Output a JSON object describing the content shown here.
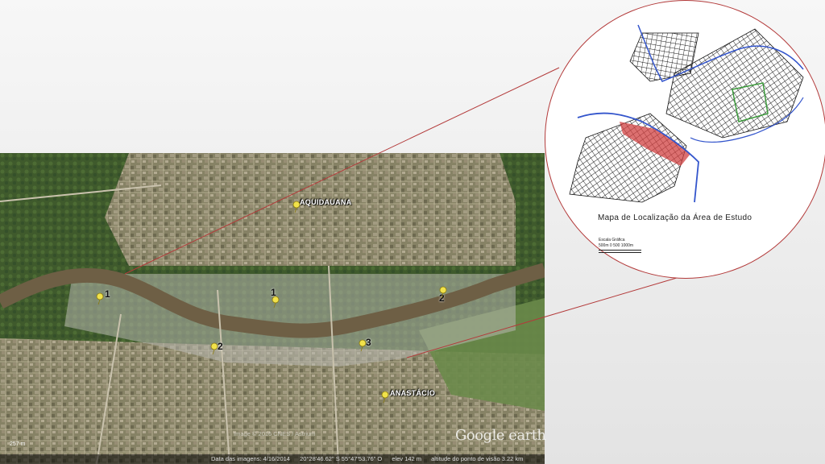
{
  "satellite": {
    "city_north": "AQUIDAUANA",
    "city_south": "ANASTÁCIO",
    "pins": [
      {
        "label": "1"
      },
      {
        "label": "1"
      },
      {
        "label": "2"
      },
      {
        "label": "2"
      },
      {
        "label": "3"
      }
    ],
    "watermark": "Google earth",
    "imagery_credit": "Image © 2016 CNES / Astrium",
    "status": {
      "date": "Data das imagens: 4/16/2014",
      "coords": "20°28'46.62\" S   55°47'53.76\" O",
      "elev": "elev  142 m",
      "eye_alt": "altitude do ponto de visão  3.22 km"
    },
    "scale_small": "257 m"
  },
  "inset": {
    "caption": "Mapa de Localização da Área de Estudo",
    "scale_title": "Escala Gráfica",
    "scale_ticks": "500m    0    500   1000m"
  },
  "colors": {
    "connector": "#b33a3a",
    "river": "#3355cc",
    "study_area": "#d04040",
    "green_area": "#3a9a3a"
  }
}
